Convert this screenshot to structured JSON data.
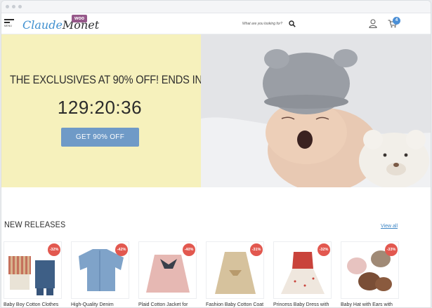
{
  "header": {
    "menu_label": "MENU",
    "logo_main": "Claude",
    "logo_second": "Monet",
    "logo_badge": "woo",
    "search_placeholder": "What are you looking for?",
    "cart_count": "4"
  },
  "hero": {
    "title": "THE EXCLUSIVES AT 90% OFF! ENDS IN",
    "countdown": "129:20:36",
    "cta_label": "GET 90% OFF"
  },
  "new_releases": {
    "title": "NEW RELEASES",
    "view_all": "View all",
    "products": [
      {
        "name": "Baby Boy Cotton Clothes",
        "discount": "-32%"
      },
      {
        "name": "High-Quality Denim",
        "discount": "-42%"
      },
      {
        "name": "Plaid Cotton Jacket for",
        "discount": "-40%"
      },
      {
        "name": "Fashion Baby Cotton Coat",
        "discount": "-31%"
      },
      {
        "name": "Princess Baby Dress with",
        "discount": "-32%"
      },
      {
        "name": "Baby Hat with Ears with",
        "discount": "-33%"
      }
    ]
  },
  "colors": {
    "accent": "#6f9ac7",
    "hero_bg": "#f6f1bc",
    "sale_badge": "#e2584f",
    "link": "#3b84c4",
    "woo_purple": "#96588a"
  }
}
